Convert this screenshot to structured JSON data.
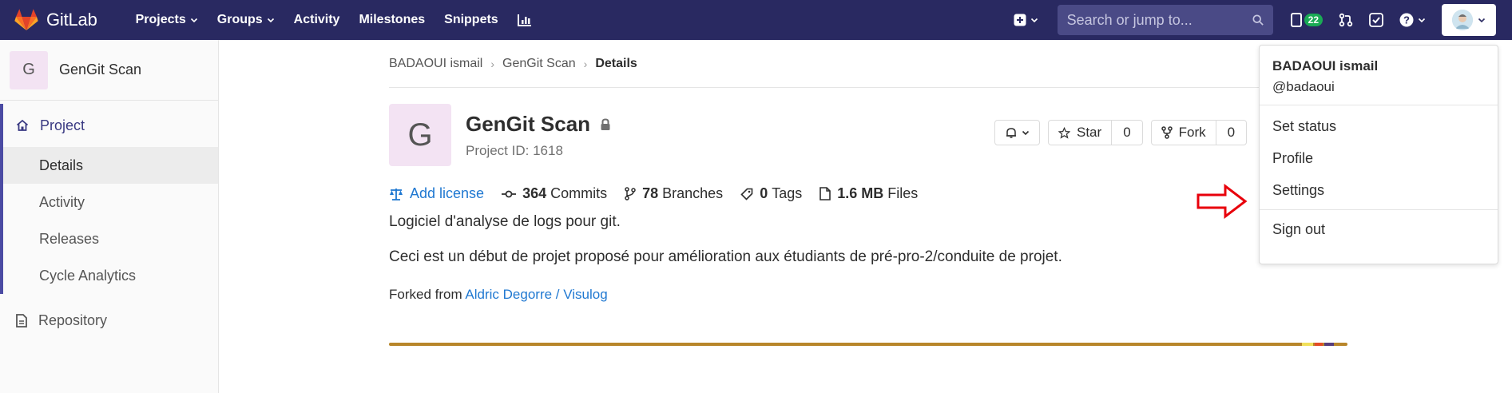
{
  "navbar": {
    "brand": "GitLab",
    "links": [
      {
        "label": "Projects",
        "dropdown": true
      },
      {
        "label": "Groups",
        "dropdown": true
      },
      {
        "label": "Activity",
        "dropdown": false
      },
      {
        "label": "Milestones",
        "dropdown": false
      },
      {
        "label": "Snippets",
        "dropdown": false
      }
    ],
    "search_placeholder": "Search or jump to...",
    "issues_count": "22",
    "bg_color": "#292961",
    "search_bg_color": "#4a4a86"
  },
  "sidebar": {
    "project_initial": "G",
    "project_name": "GenGit Scan",
    "section_title": "Project",
    "items": [
      {
        "label": "Details",
        "active": true
      },
      {
        "label": "Activity",
        "active": false
      },
      {
        "label": "Releases",
        "active": false
      },
      {
        "label": "Cycle Analytics",
        "active": false
      }
    ],
    "repository": "Repository"
  },
  "breadcrumb": {
    "items": [
      "BADAOUI ismail",
      "GenGit Scan",
      "Details"
    ]
  },
  "project": {
    "initial": "G",
    "name": "GenGit Scan",
    "id_text": "Project ID: 1618",
    "star_label": "Star",
    "star_count": "0",
    "fork_label": "Fork",
    "fork_count": "0"
  },
  "stats": {
    "add_license": "Add license",
    "commits_count": "364",
    "commits_label": "Commits",
    "branches_count": "78",
    "branches_label": "Branches",
    "tags_count": "0",
    "tags_label": "Tags",
    "files_size": "1.6 MB",
    "files_label": "Files"
  },
  "description": {
    "line1": "Logiciel d'analyse de logs pour git.",
    "line2": "Ceci est un début de projet proposé pour amélioration aux étudiants de pré-pro-2/conduite de projet.",
    "forked_prefix": "Forked from ",
    "forked_link": "Aldric Degorre / Visulog"
  },
  "user_dropdown": {
    "name": "BADAOUI ismail",
    "handle": "@badaoui",
    "items": [
      "Set status",
      "Profile",
      "Settings"
    ],
    "sign_out": "Sign out"
  },
  "colors": {
    "accent_link": "#1f78d1",
    "sidebar_accent": "#4b4ba3",
    "annotation_arrow": "#e8000b",
    "language_bar": "#b8862a"
  }
}
